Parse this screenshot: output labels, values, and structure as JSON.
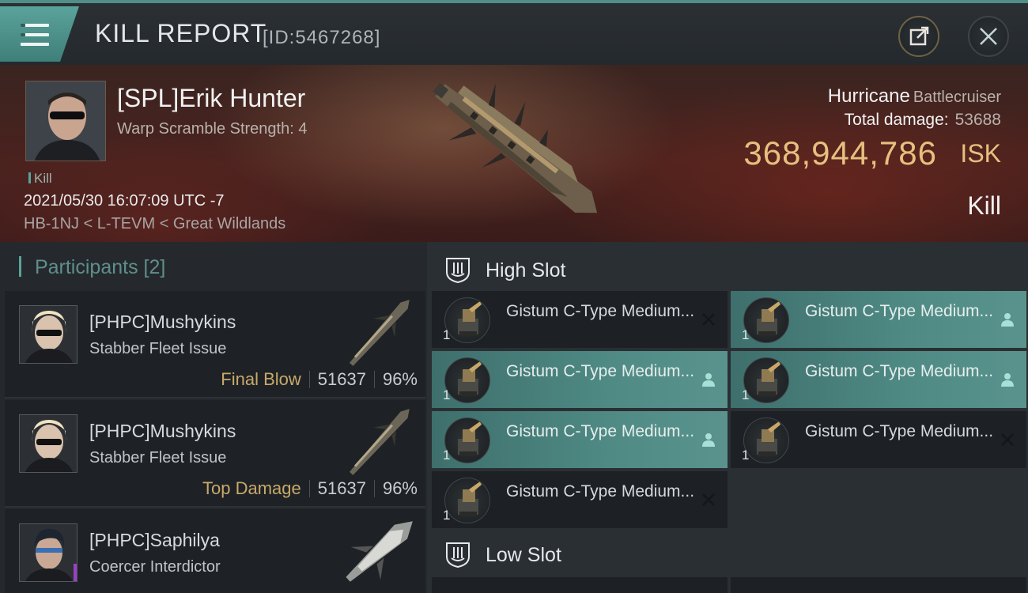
{
  "header": {
    "title": "KILL REPORT",
    "id_text": "[ID:5467268]",
    "menu_icon": "hamburger-menu-icon",
    "share_icon": "share-external-icon",
    "close_icon": "close-icon"
  },
  "victim": {
    "pilot_name": "[SPL]Erik Hunter",
    "warp_scramble": "Warp Scramble Strength: 4",
    "kill_tag": "Kill",
    "datetime": "2021/05/30 16:07:09 UTC -7",
    "location": "HB-1NJ < L-TEVM < Great Wildlands",
    "ship_name": "Hurricane",
    "ship_class": "Battlecruiser",
    "total_damage_label": "Total damage:",
    "total_damage_value": "53688",
    "isk_value": "368,944,786",
    "isk_unit": "ISK",
    "kill_type": "Kill"
  },
  "participants": {
    "heading": "Participants",
    "count": "[2]",
    "items": [
      {
        "name": "[PHPC]Mushykins",
        "ship": "Stabber Fleet Issue",
        "role": "Final Blow",
        "damage": "51637",
        "percent": "96%"
      },
      {
        "name": "[PHPC]Mushykins",
        "ship": "Stabber Fleet Issue",
        "role": "Top Damage",
        "damage": "51637",
        "percent": "96%"
      },
      {
        "name": "[PHPC]Saphilya",
        "ship": "Coercer Interdictor",
        "role": "",
        "damage": "",
        "percent": ""
      }
    ]
  },
  "slots": {
    "high_label": "High Slot",
    "low_label": "Low Slot",
    "high_modules": [
      {
        "name": "Gistum C-Type Medium...",
        "qty": "1",
        "status": "destroyed",
        "highlight": false
      },
      {
        "name": "Gistum C-Type Medium...",
        "qty": "1",
        "status": "dropped",
        "highlight": true
      },
      {
        "name": "Gistum C-Type Medium...",
        "qty": "1",
        "status": "dropped",
        "highlight": true
      },
      {
        "name": "Gistum C-Type Medium...",
        "qty": "1",
        "status": "dropped",
        "highlight": true
      },
      {
        "name": "Gistum C-Type Medium...",
        "qty": "1",
        "status": "dropped",
        "highlight": true
      },
      {
        "name": "Gistum C-Type Medium...",
        "qty": "1",
        "status": "destroyed",
        "highlight": false
      },
      {
        "name": "Gistum C-Type Medium...",
        "qty": "1",
        "status": "destroyed",
        "highlight": false
      }
    ]
  },
  "colors": {
    "accent_teal": "#5aa39b",
    "isk_gold": "#e6c07f",
    "role_gold": "#c8a96a"
  }
}
